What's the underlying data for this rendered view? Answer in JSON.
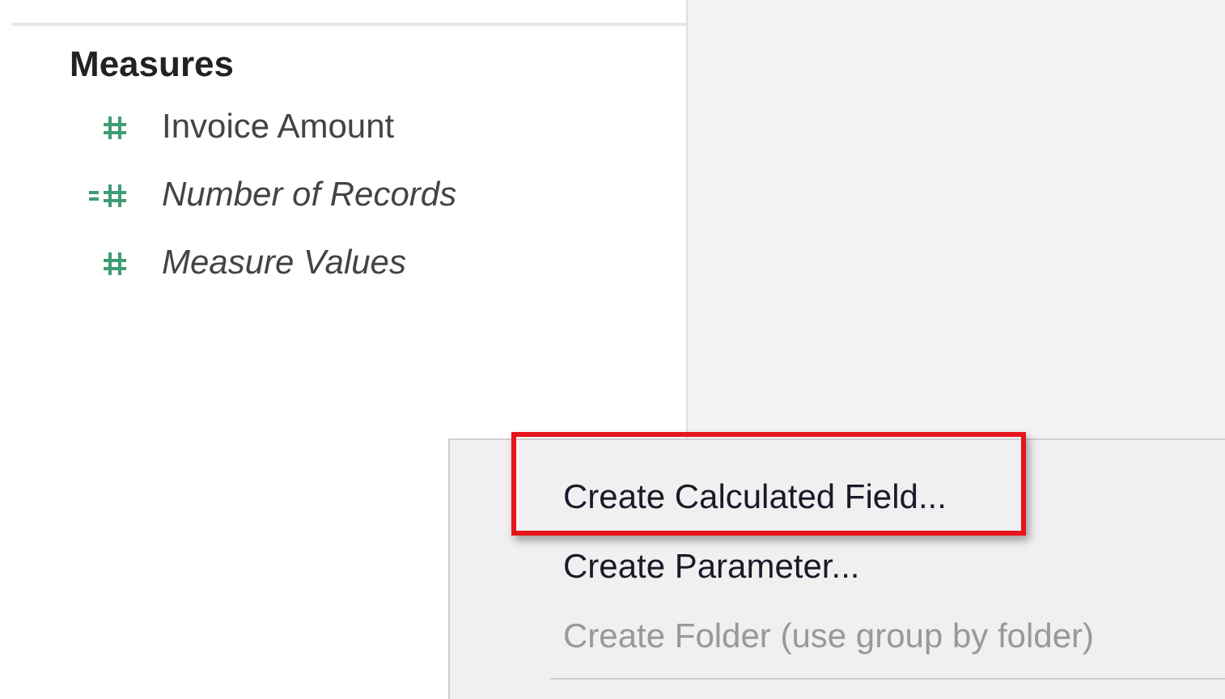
{
  "data_pane": {
    "section_title": "Measures",
    "fields": [
      {
        "name": "Invoice Amount",
        "italic": false,
        "calculated": false
      },
      {
        "name": "Number of Records",
        "italic": true,
        "calculated": true
      },
      {
        "name": "Measure Values",
        "italic": true,
        "calculated": false
      }
    ]
  },
  "context_menu": {
    "items": [
      {
        "label": "Create Calculated Field...",
        "disabled": false,
        "highlighted": true
      },
      {
        "label": "Create Parameter...",
        "disabled": false,
        "highlighted": false
      },
      {
        "label": "Create Folder (use group by folder)",
        "disabled": true,
        "highlighted": false
      }
    ]
  }
}
